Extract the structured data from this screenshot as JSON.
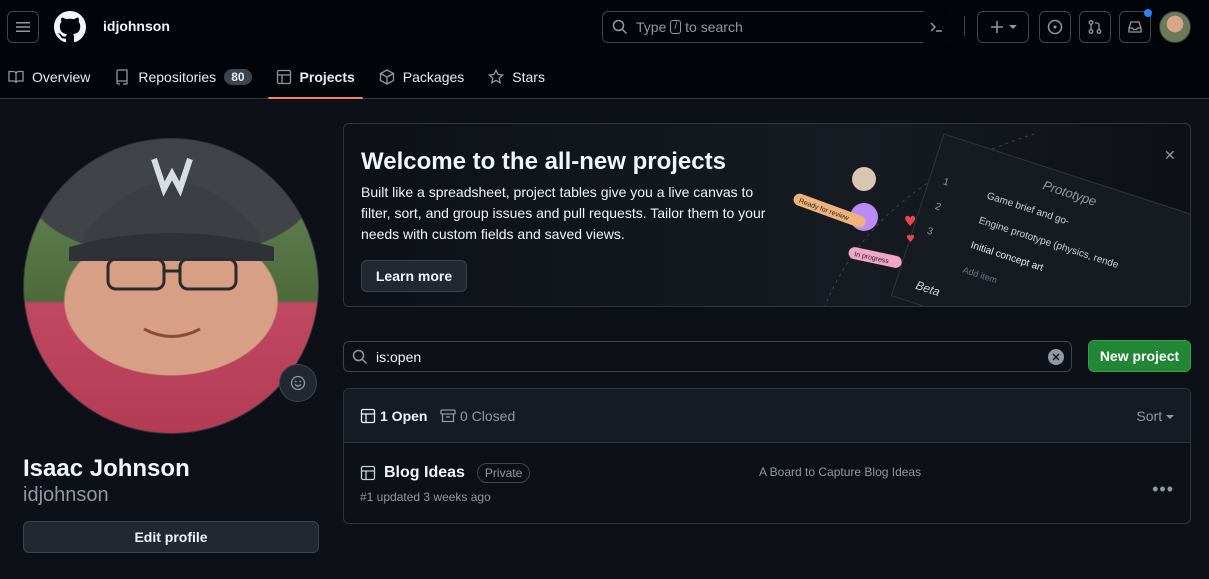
{
  "header": {
    "username": "idjohnson",
    "search_placeholder_prefix": "Type",
    "search_key": "/",
    "search_placeholder_suffix": "to search"
  },
  "tabs": [
    {
      "label": "Overview",
      "icon": "book-icon"
    },
    {
      "label": "Repositories",
      "icon": "repo-icon",
      "count": "80"
    },
    {
      "label": "Projects",
      "icon": "table-icon",
      "active": true
    },
    {
      "label": "Packages",
      "icon": "package-icon"
    },
    {
      "label": "Stars",
      "icon": "star-icon"
    }
  ],
  "profile": {
    "full_name": "Isaac Johnson",
    "login": "idjohnson",
    "edit_label": "Edit profile"
  },
  "banner": {
    "title": "Welcome to the all-new projects",
    "body": "Built like a spreadsheet, project tables give you a live canvas to filter, sort, and group issues and pull requests. Tailor them to your needs with custom fields and saved views.",
    "learn_more": "Learn more",
    "illustration": {
      "prototype": "Prototype",
      "row1_num": "1",
      "row1": "Game brief and go-",
      "row2_num": "2",
      "row2": "Engine prototype (physics, rende",
      "row3_num": "3",
      "row3": "Initial concept art",
      "add_item": "Add item",
      "beta": "Beta",
      "ready_tag": "Ready for review",
      "progress_tag": "In progress"
    }
  },
  "filter": {
    "query": "is:open",
    "new_project": "New project"
  },
  "list": {
    "open_label": "1 Open",
    "closed_label": "0 Closed",
    "sort_label": "Sort",
    "projects": [
      {
        "title": "Blog Ideas",
        "visibility": "Private",
        "meta": "#1 updated 3 weeks ago",
        "description": "A Board to Capture Blog Ideas"
      }
    ]
  },
  "colors": {
    "accent_underline": "#f78166",
    "primary_button": "#238636",
    "notification_dot": "#2f81f7"
  }
}
